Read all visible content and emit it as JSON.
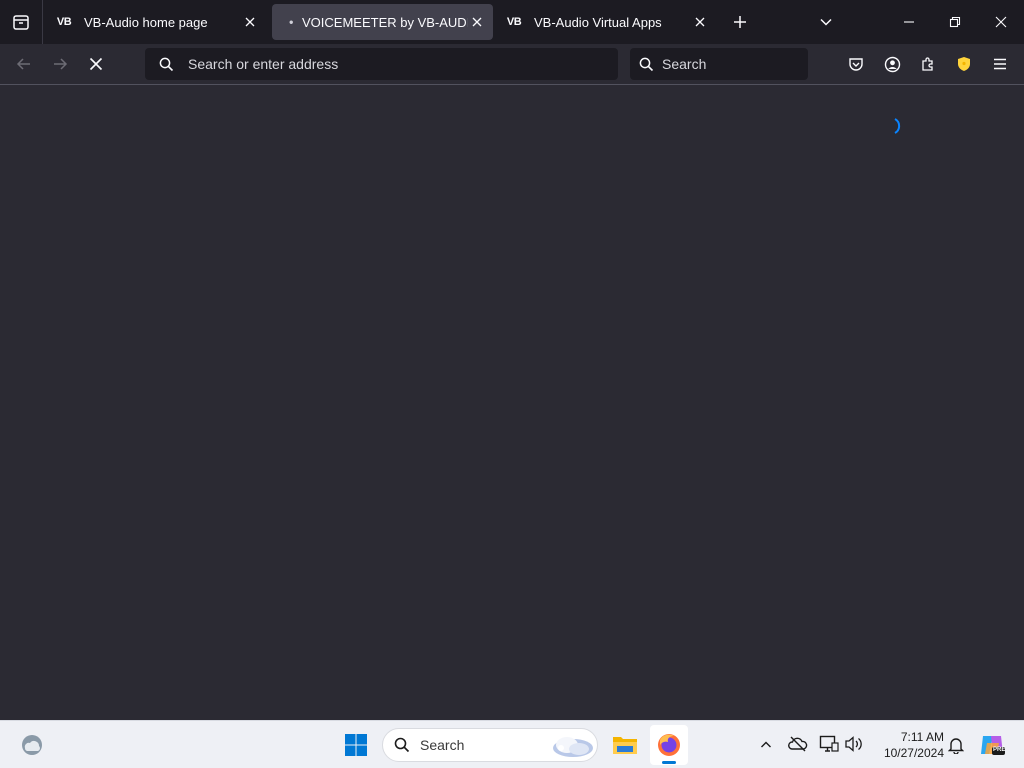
{
  "browser": {
    "tabs": [
      {
        "favicon": "VB",
        "title": "VB-Audio home page",
        "active": false
      },
      {
        "favicon": "•",
        "title": "VOICEMEETER by VB-AUDIO – T",
        "active": true
      },
      {
        "favicon": "VB",
        "title": "VB-Audio Virtual Apps",
        "active": false
      }
    ],
    "address_placeholder": "Search or enter address",
    "search_placeholder": "Search"
  },
  "taskbar": {
    "search_placeholder": "Search",
    "time": "7:11 AM",
    "date": "10/27/2024"
  },
  "colors": {
    "accent_blue": "#0a84ff",
    "vpn_shield": "#ffd43b",
    "windows_blue": "#0078d4"
  }
}
